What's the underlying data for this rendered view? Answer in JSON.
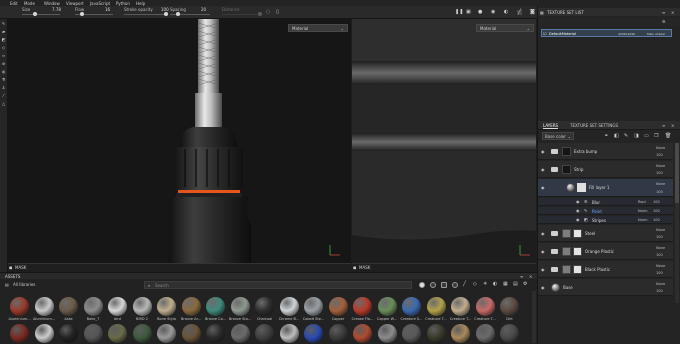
{
  "menu": {
    "items": [
      "Edit",
      "Mode",
      "Window",
      "Viewport",
      "JavaScript",
      "Python",
      "Help"
    ]
  },
  "toolbar": {
    "size_label": "Size",
    "size_value": "7.78",
    "flow_label": "Flow",
    "flow_value": "16",
    "stroke_opacity_label": "Stroke opacity",
    "stroke_opacity_value": "100",
    "spacing_label": "Spacing",
    "spacing_value": "20",
    "distance_label": "Distance"
  },
  "viewport3d": {
    "dropdown": "Material",
    "mask_label": "MASK"
  },
  "viewport2d": {
    "dropdown": "Material",
    "mask_label": "MASK"
  },
  "texture_set_list": {
    "title": "TEXTURE SET LIST",
    "row_name": "DefaultMaterial",
    "row_size": "4096x4096",
    "row_shader": "Main shader"
  },
  "layers": {
    "tab_layers": "LAYERS",
    "tab_settings": "TEXTURE SET SETTINGS",
    "channel": "Base color",
    "rows": [
      {
        "name": "Extra bump",
        "blend": "None",
        "opacity": "100"
      },
      {
        "name": "Strip",
        "blend": "None",
        "opacity": "100"
      },
      {
        "name": "Fill layer 1",
        "blend": "None",
        "opacity": "100"
      },
      {
        "name": "Blur",
        "blend": "Repl",
        "opacity": "100"
      },
      {
        "name": "Paint",
        "blend": "Norm",
        "opacity": "100"
      },
      {
        "name": "Stripes",
        "blend": "Norm",
        "opacity": "100"
      },
      {
        "name": "Steel",
        "blend": "None",
        "opacity": "100"
      },
      {
        "name": "Orange Plastic",
        "blend": "None",
        "opacity": "100"
      },
      {
        "name": "Black Plastic",
        "blend": "None",
        "opacity": "100"
      },
      {
        "name": "Base",
        "blend": "None",
        "opacity": "100"
      }
    ]
  },
  "assets": {
    "title": "ASSETS",
    "library": "All libraries",
    "search_placeholder": "Search",
    "materials": [
      {
        "label": "Aluminium...",
        "color": "#9a3a2a"
      },
      {
        "label": "Aluminium...",
        "color": "#c9c9c9"
      },
      {
        "label": "Aske",
        "color": "#6a5a48"
      },
      {
        "label": "Bake_T",
        "color": "#8c8c8c"
      },
      {
        "label": "bird",
        "color": "#d8d8d8"
      },
      {
        "label": "BIRD 2",
        "color": "#b8b8b8"
      },
      {
        "label": "Bone Stylo",
        "color": "#bfae8c"
      },
      {
        "label": "Bronze Ar...",
        "color": "#8a6a3e"
      },
      {
        "label": "Bronze Co...",
        "color": "#3f8a7c"
      },
      {
        "label": "Bronze Sto...",
        "color": "#8e9a90"
      },
      {
        "label": "Charcoal",
        "color": "#2e2e2e"
      },
      {
        "label": "Chrome B...",
        "color": "#cfd4d8"
      },
      {
        "label": "Cobalt Ste...",
        "color": "#9aa0a6"
      },
      {
        "label": "Copper",
        "color": "#a3603a"
      },
      {
        "label": "Crease Fla...",
        "color": "#b83a2a"
      },
      {
        "label": "Copper W...",
        "color": "#6a8c58"
      },
      {
        "label": "Creature S...",
        "color": "#3a6ab0"
      },
      {
        "label": "Creature T...",
        "color": "#b3a24a"
      },
      {
        "label": "Creature T...",
        "color": "#c2ad8e"
      },
      {
        "label": "Creature T...",
        "color": "#c86868"
      },
      {
        "label": "Dirt",
        "color": "#5a4a40"
      }
    ],
    "row2_colors": [
      "#7a2a22",
      "#cccccc",
      "#222222",
      "#555555",
      "#6a6a4a",
      "#3e5a3e",
      "#9a9a9a",
      "#6a5438",
      "#2a2a2a",
      "#6a6a6a",
      "#3e3e3e",
      "#bcbcbc",
      "#2a4ab0",
      "#3a3a3a",
      "#b04a30",
      "#8c8c8c",
      "#5a5a5a",
      "#3a3a2a",
      "#aa8a5a",
      "#6a6a6a",
      "#4a4a4a"
    ]
  }
}
